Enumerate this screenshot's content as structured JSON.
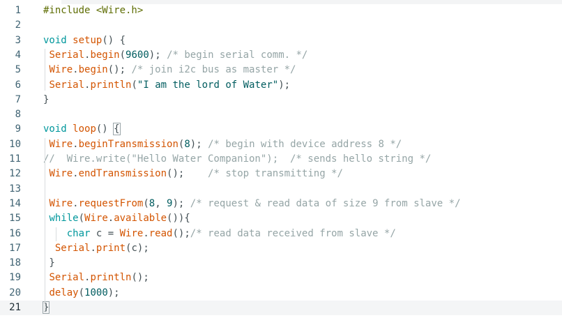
{
  "editor": {
    "lines": [
      {
        "number": "1",
        "tokens": [
          [
            "tok-pre",
            "#include <Wire.h>"
          ]
        ]
      },
      {
        "number": "2",
        "tokens": []
      },
      {
        "number": "3",
        "tokens": [
          [
            "tok-kw",
            "void"
          ],
          [
            "tok-plain",
            " "
          ],
          [
            "tok-fn",
            "setup"
          ],
          [
            "tok-plain",
            "() {"
          ]
        ]
      },
      {
        "number": "4",
        "tokens": [
          [
            "tok-plain",
            " "
          ],
          [
            "tok-fn",
            "Serial"
          ],
          [
            "tok-plain",
            "."
          ],
          [
            "tok-fn",
            "begin"
          ],
          [
            "tok-plain",
            "("
          ],
          [
            "tok-num",
            "9600"
          ],
          [
            "tok-plain",
            "); "
          ],
          [
            "tok-cm",
            "/* begin serial comm. */"
          ]
        ]
      },
      {
        "number": "5",
        "tokens": [
          [
            "tok-plain",
            " "
          ],
          [
            "tok-fn",
            "Wire"
          ],
          [
            "tok-plain",
            "."
          ],
          [
            "tok-fn",
            "begin"
          ],
          [
            "tok-plain",
            "(); "
          ],
          [
            "tok-cm",
            "/* join i2c bus as master */"
          ]
        ]
      },
      {
        "number": "6",
        "tokens": [
          [
            "tok-plain",
            " "
          ],
          [
            "tok-fn",
            "Serial"
          ],
          [
            "tok-plain",
            "."
          ],
          [
            "tok-fn",
            "println"
          ],
          [
            "tok-plain",
            "("
          ],
          [
            "tok-str",
            "\"I am the lord of Water\""
          ],
          [
            "tok-plain",
            ");"
          ]
        ]
      },
      {
        "number": "7",
        "tokens": [
          [
            "tok-plain",
            "}"
          ]
        ]
      },
      {
        "number": "8",
        "tokens": []
      },
      {
        "number": "9",
        "tokens": [
          [
            "tok-kw",
            "void"
          ],
          [
            "tok-plain",
            " "
          ],
          [
            "tok-fn",
            "loop"
          ],
          [
            "tok-plain",
            "() "
          ],
          [
            "bracket",
            "{"
          ]
        ]
      },
      {
        "number": "10",
        "tokens": [
          [
            "tok-plain",
            " "
          ],
          [
            "tok-fn",
            "Wire"
          ],
          [
            "tok-plain",
            "."
          ],
          [
            "tok-fn",
            "beginTransmission"
          ],
          [
            "tok-plain",
            "("
          ],
          [
            "tok-num",
            "8"
          ],
          [
            "tok-plain",
            "); "
          ],
          [
            "tok-cm",
            "/* begin with device address 8 */"
          ]
        ]
      },
      {
        "number": "11",
        "tokens": [
          [
            "tok-cm",
            "//  Wire.write(\"Hello Water Companion\");  /* sends hello string */"
          ]
        ]
      },
      {
        "number": "12",
        "tokens": [
          [
            "tok-plain",
            " "
          ],
          [
            "tok-fn",
            "Wire"
          ],
          [
            "tok-plain",
            "."
          ],
          [
            "tok-fn",
            "endTransmission"
          ],
          [
            "tok-plain",
            "();    "
          ],
          [
            "tok-cm",
            "/* stop transmitting */"
          ]
        ]
      },
      {
        "number": "13",
        "tokens": []
      },
      {
        "number": "14",
        "tokens": [
          [
            "tok-plain",
            " "
          ],
          [
            "tok-fn",
            "Wire"
          ],
          [
            "tok-plain",
            "."
          ],
          [
            "tok-fn",
            "requestFrom"
          ],
          [
            "tok-plain",
            "("
          ],
          [
            "tok-num",
            "8"
          ],
          [
            "tok-plain",
            ", "
          ],
          [
            "tok-num",
            "9"
          ],
          [
            "tok-plain",
            "); "
          ],
          [
            "tok-cm",
            "/* request & read data of size 9 from slave */"
          ]
        ]
      },
      {
        "number": "15",
        "tokens": [
          [
            "tok-plain",
            " "
          ],
          [
            "tok-kw",
            "while"
          ],
          [
            "tok-plain",
            "("
          ],
          [
            "tok-fn",
            "Wire"
          ],
          [
            "tok-plain",
            "."
          ],
          [
            "tok-fn",
            "available"
          ],
          [
            "tok-plain",
            "()){"
          ]
        ]
      },
      {
        "number": "16",
        "tokens": [
          [
            "tok-plain",
            "    "
          ],
          [
            "tok-kw",
            "char"
          ],
          [
            "tok-plain",
            " c = "
          ],
          [
            "tok-fn",
            "Wire"
          ],
          [
            "tok-plain",
            "."
          ],
          [
            "tok-fn",
            "read"
          ],
          [
            "tok-plain",
            "();"
          ],
          [
            "tok-cm",
            "/* read data received from slave */"
          ]
        ]
      },
      {
        "number": "17",
        "tokens": [
          [
            "tok-plain",
            "  "
          ],
          [
            "tok-fn",
            "Serial"
          ],
          [
            "tok-plain",
            "."
          ],
          [
            "tok-fn",
            "print"
          ],
          [
            "tok-plain",
            "(c);"
          ]
        ]
      },
      {
        "number": "18",
        "tokens": [
          [
            "tok-plain",
            " }"
          ]
        ]
      },
      {
        "number": "19",
        "tokens": [
          [
            "tok-plain",
            " "
          ],
          [
            "tok-fn",
            "Serial"
          ],
          [
            "tok-plain",
            "."
          ],
          [
            "tok-fn",
            "println"
          ],
          [
            "tok-plain",
            "();"
          ]
        ]
      },
      {
        "number": "20",
        "tokens": [
          [
            "tok-plain",
            " "
          ],
          [
            "tok-fn",
            "delay"
          ],
          [
            "tok-plain",
            "("
          ],
          [
            "tok-num",
            "1000"
          ],
          [
            "tok-plain",
            ");"
          ]
        ]
      },
      {
        "number": "21",
        "tokens": [
          [
            "bracket",
            "}"
          ],
          [
            "cursor",
            ""
          ]
        ]
      }
    ],
    "current_line": 21,
    "colors": {
      "keyword": "#00979c",
      "function": "#d35400",
      "comment": "#95a5a6",
      "preprocessor": "#5e6d03",
      "line_number": "#3f6373",
      "current_line_bg": "#f4f5f6"
    }
  }
}
